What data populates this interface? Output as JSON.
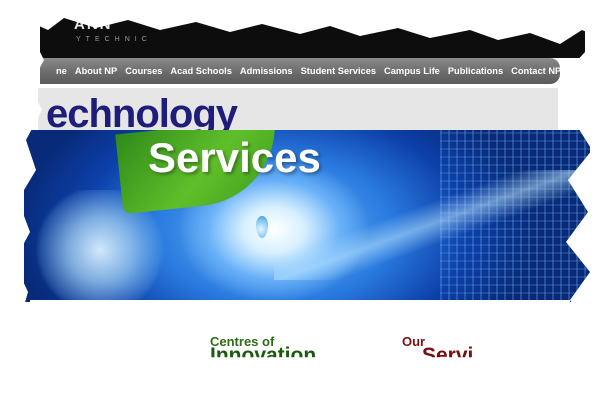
{
  "header": {
    "logo_text": "ANN",
    "logo_subtext": "YTECHNIC"
  },
  "nav": {
    "items": [
      {
        "label": "ne"
      },
      {
        "label": "About NP"
      },
      {
        "label": "Courses"
      },
      {
        "label": "Acad Schools"
      },
      {
        "label": "Admissions"
      },
      {
        "label": "Student Services"
      },
      {
        "label": "Campus Life"
      },
      {
        "label": "Publications"
      },
      {
        "label": "Contact NP"
      }
    ]
  },
  "page": {
    "title": "echnology"
  },
  "hero": {
    "title": "Services"
  },
  "sections": {
    "centres": {
      "line1": "Centres of",
      "line2": "Innovation"
    },
    "our": {
      "line1": "Our",
      "line2": "Servi"
    }
  },
  "colors": {
    "header_bg": "#0d0d0d",
    "nav_bg": "#6c6c6c",
    "title_color": "#1f1d7a",
    "hero_blue": "#2a7be0",
    "leaf_green": "#5fbf2a",
    "centres_green": "#2e6d18",
    "our_red": "#7a1010"
  }
}
